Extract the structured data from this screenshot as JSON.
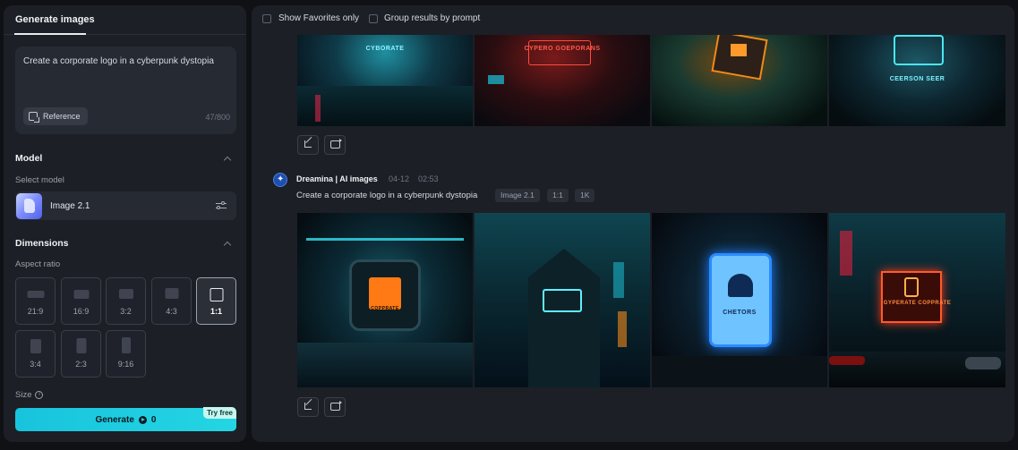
{
  "left_panel": {
    "tab": "Generate images",
    "prompt": {
      "value": "Create a corporate logo in a cyberpunk dystopia",
      "reference_label": "Reference",
      "char_count": "47/800"
    },
    "model_section": {
      "title": "Model",
      "select_label": "Select model",
      "model_name": "Image 2.1"
    },
    "dimensions_section": {
      "title": "Dimensions",
      "aspect_label": "Aspect ratio",
      "ratios": [
        "21:9",
        "16:9",
        "3:2",
        "4:3",
        "1:1",
        "3:4",
        "2:3",
        "9:16"
      ],
      "selected_ratio": "1:1"
    },
    "size_label": "Size",
    "generate": {
      "label": "Generate",
      "cost": "0",
      "badge": "Try free"
    }
  },
  "right_panel": {
    "filters": {
      "show_favorites": "Show Favorites only",
      "group_by_prompt": "Group results by prompt"
    },
    "top_group": {
      "image_logos": [
        "CYBORATE",
        "CYPERO GOEPORANS",
        "",
        "CEERSON SEER"
      ]
    },
    "group": {
      "author": "Dreamina | AI images",
      "date": "04-12",
      "time": "02:53",
      "prompt": "Create a corporate logo in a cyberpunk dystopia",
      "tags": [
        "Image 2.1",
        "1:1",
        "1K"
      ],
      "image_logos": [
        "COPPRATE",
        "",
        "CHETORS",
        "GYPERATE COPPRATE"
      ]
    }
  },
  "colors": {
    "accent": "#24d5e3",
    "panel_bg": "#1c1f26",
    "page_bg": "#0f1115"
  }
}
